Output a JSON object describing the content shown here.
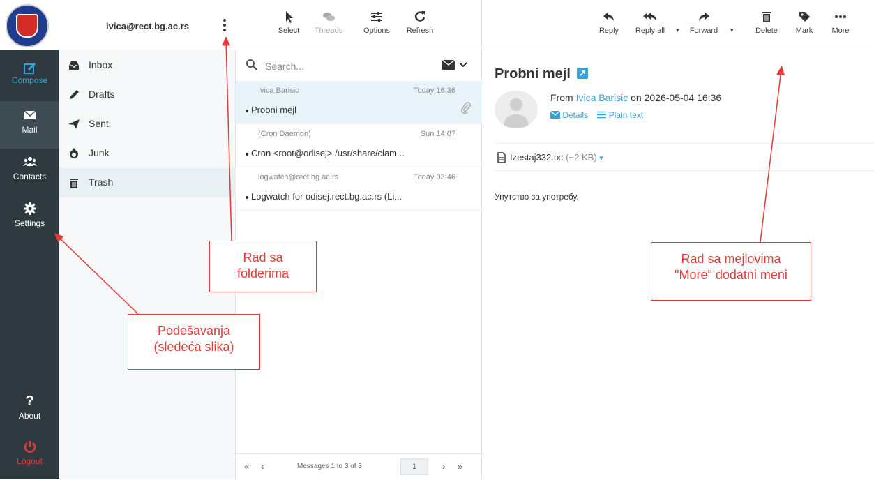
{
  "nav": {
    "items": [
      {
        "label": "Compose"
      },
      {
        "label": "Mail"
      },
      {
        "label": "Contacts"
      },
      {
        "label": "Settings"
      },
      {
        "label": "About"
      },
      {
        "label": "Logout"
      }
    ]
  },
  "folders": {
    "account": "ivica@rect.bg.ac.rs",
    "items": [
      {
        "label": "Inbox"
      },
      {
        "label": "Drafts"
      },
      {
        "label": "Sent"
      },
      {
        "label": "Junk"
      },
      {
        "label": "Trash"
      }
    ]
  },
  "list_toolbar": {
    "select": "Select",
    "threads": "Threads",
    "options": "Options",
    "refresh": "Refresh"
  },
  "search": {
    "placeholder": "Search..."
  },
  "messages": [
    {
      "from": "Ivica Barisic",
      "date": "Today 16:36",
      "subject": "Probni mejl"
    },
    {
      "from": "(Cron Daemon)",
      "date": "Sun 14:07",
      "subject": "Cron <root@odisej> /usr/share/clam..."
    },
    {
      "from": "logwatch@rect.bg.ac.rs",
      "date": "Today 03:46",
      "subject": "Logwatch for odisej.rect.bg.ac.rs (Li..."
    }
  ],
  "pager": {
    "first": "«",
    "prev": "‹",
    "info": "Messages 1 to 3 of 3",
    "page": "1",
    "next": "›",
    "last": "»"
  },
  "pane_toolbar": {
    "reply": "Reply",
    "reply_all": "Reply all",
    "forward": "Forward",
    "delete": "Delete",
    "mark": "Mark",
    "more": "More"
  },
  "mail": {
    "subject": "Probni mejl",
    "from_prefix": "From",
    "from_name": "Ivica Barisic",
    "date_text": "on 2026-05-04 16:36",
    "details": "Details",
    "plain_text": "Plain text",
    "attachment_name": "Izestaj332.txt",
    "attachment_size": "(~2 KB)",
    "body": "Упутство за употребу."
  },
  "annotations": {
    "folders": "Rad sa folderima",
    "folders_l1": "Rad sa",
    "folders_l2": "folderima",
    "settings_l1": "Podešavanja",
    "settings_l2": "(sledeća slika)",
    "mail_l1": "Rad sa mejlovima",
    "mail_l2": "\"More\" dodatni meni"
  },
  "colors": {
    "nav_bg": "#2f3a40",
    "accent": "#37a2d4",
    "annotation": "#e53935",
    "logout": "#e53935"
  }
}
